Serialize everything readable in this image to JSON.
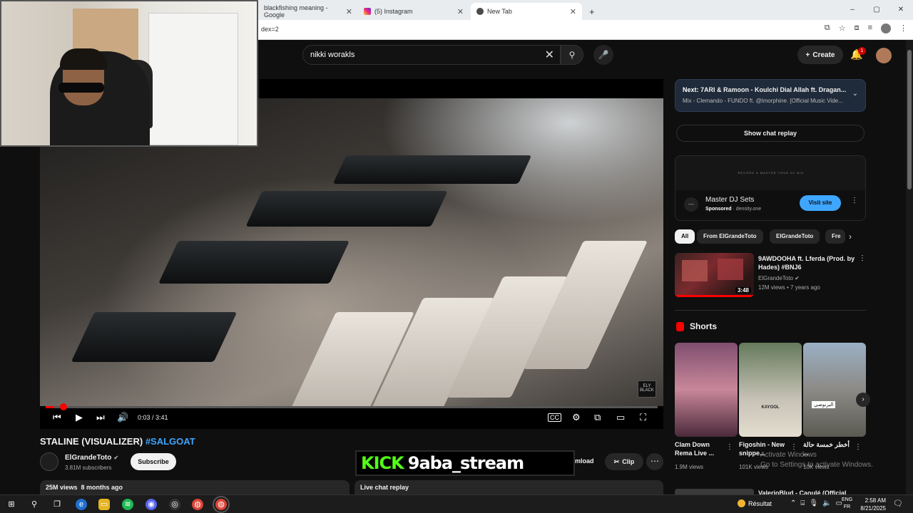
{
  "browser": {
    "tabs": [
      {
        "label": "blackfishing meaning - Google",
        "icon": "google-icon"
      },
      {
        "label": "(5) Instagram",
        "icon": "instagram-icon"
      },
      {
        "label": "New Tab",
        "icon": "chrome-icon"
      }
    ],
    "new_tab": "+",
    "address_fragment": "dex=2",
    "window_controls": [
      "–",
      "▢",
      "✕"
    ]
  },
  "yt_header": {
    "search_value": "nikki worakls",
    "create_label": "Create",
    "notification_count": "1"
  },
  "player": {
    "time": "0:03 / 3:41",
    "progress_fraction": 0.014,
    "logo_badge": "ELY BLACK"
  },
  "video": {
    "title": "STALINE (VISUALIZER)",
    "hashtag": "#SALGOAT",
    "channel": "ElGrandeToto",
    "subscribers": "3.81M subscribers",
    "subscribe_label": "Subscribe",
    "download_label": "mload",
    "clip_label": "Clip",
    "views": "25M views",
    "age": "8 months ago",
    "live_chat": "Live chat replay"
  },
  "overlay": {
    "kick_logo": "KICK",
    "kick_user": "9aba_stream"
  },
  "sidebar": {
    "next_label": "Next:",
    "next_title": "7ARI & Ramoon - Koulchi Dial Allah ft. Dragan...",
    "next_subtitle": "Mix - Clemando - FUNDO ft. @lmorphine. [Official Music Vide...",
    "chat_replay": "Show chat replay",
    "ad": {
      "banner_text": "RECORD & MASTER YOUR DJ MIX",
      "title": "Master DJ Sets",
      "sponsored": "Sponsored",
      "domain": "density.one",
      "visit": "Visit site"
    },
    "chips": [
      "All",
      "From ElGrandeToto",
      "ElGrandeToto",
      "Fre"
    ],
    "recommendation": {
      "title": "9AWDOOHA ft. Lferda (Prod. by Hades) #BNJ6",
      "channel": "ElGrandeToto",
      "stats": "12M views • 7 years ago",
      "duration": "3:48"
    },
    "shorts_heading": "Shorts",
    "shorts": [
      {
        "title": "Clam Down Rema Live ...",
        "views": "1.9M views"
      },
      {
        "title": "Figoshin - New snippe...",
        "views": "101K views",
        "thumb_label": "KAYOOL"
      },
      {
        "title": "أخطر خمسة حالة ...",
        "views": "10K views",
        "thumb_label": "البرنوصي"
      }
    ],
    "next_peek": "ValerioBlud - Caoulé (Official",
    "activate_windows_1": "Activate Windows",
    "activate_windows_2": "Go to Settings to activate Windows."
  },
  "taskbar": {
    "weather_label": "Résultat",
    "lang_1": "ENG",
    "lang_2": "FR",
    "time": "2:58 AM",
    "date": "8/21/2025"
  },
  "colors": {
    "accent_red": "#ff0000",
    "link_blue": "#3ea6ff",
    "kick_green": "#53fc18"
  }
}
